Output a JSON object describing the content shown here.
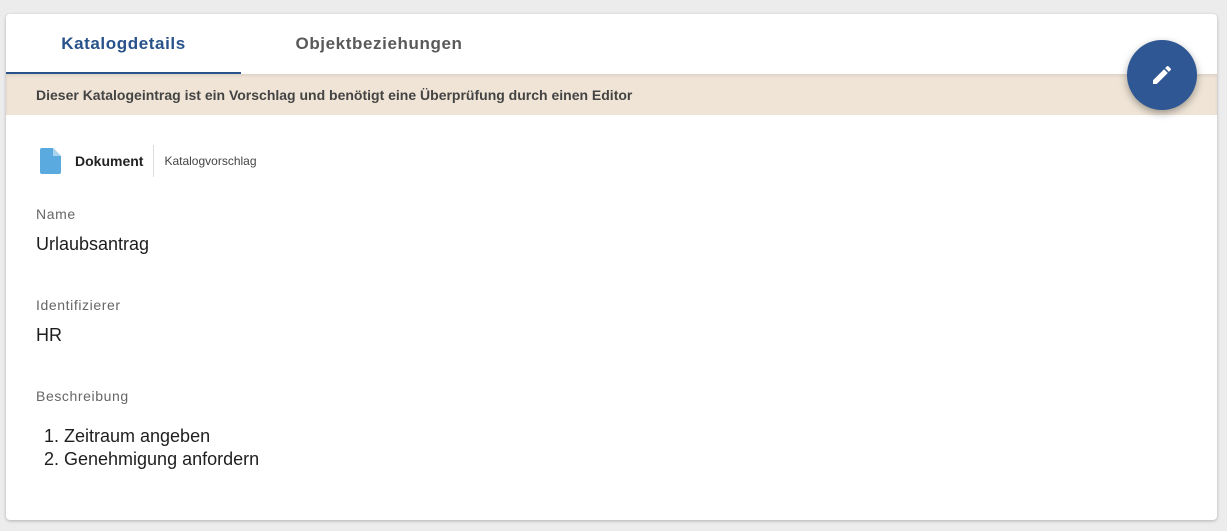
{
  "tabs": [
    {
      "label": "Katalogdetails",
      "active": true
    },
    {
      "label": "Objektbeziehungen",
      "active": false
    }
  ],
  "banner": {
    "text": "Dieser Katalogeintrag ist ein Vorschlag und benötigt eine Überprüfung durch einen Editor"
  },
  "fab": {
    "icon": "pencil-icon"
  },
  "item": {
    "type_icon": "document-icon",
    "type_label": "Dokument",
    "status_label": "Katalogvorschlag"
  },
  "fields": {
    "name_label": "Name",
    "name_value": "Urlaubsantrag",
    "identifier_label": "Identifizierer",
    "identifier_value": "HR",
    "description_label": "Beschreibung",
    "description_items": [
      "Zeitraum angeben",
      "Genehmigung anfordern"
    ]
  },
  "colors": {
    "accent": "#28528a",
    "fab": "#2f5793",
    "banner_bg": "#efe4d6",
    "doc_icon": "#5aaae0"
  }
}
